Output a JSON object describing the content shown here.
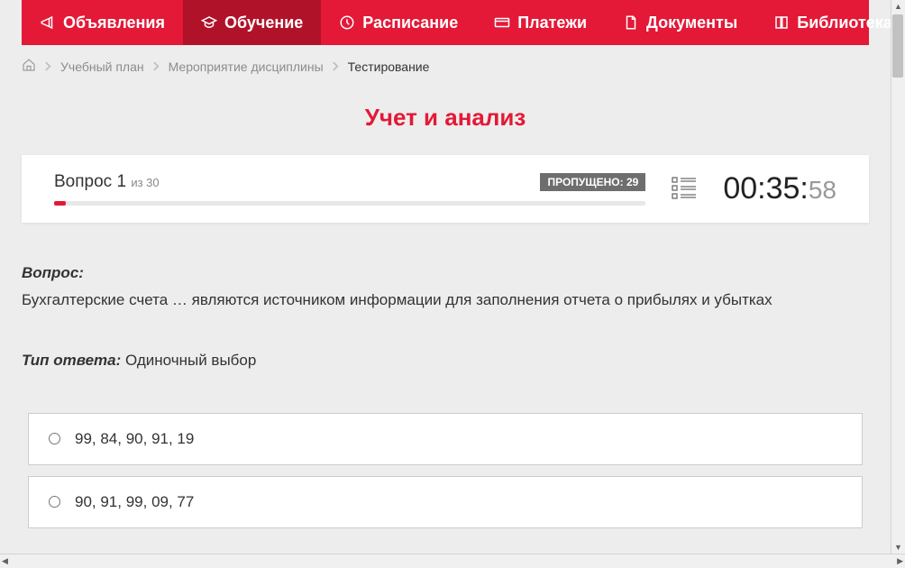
{
  "nav": {
    "items": [
      {
        "label": "Объявления",
        "icon": "megaphone"
      },
      {
        "label": "Обучение",
        "icon": "graduation",
        "active": true
      },
      {
        "label": "Расписание",
        "icon": "clock"
      },
      {
        "label": "Платежи",
        "icon": "card"
      },
      {
        "label": "Документы",
        "icon": "doc"
      },
      {
        "label": "Библиотека",
        "icon": "book",
        "dropdown": true
      }
    ]
  },
  "breadcrumb": {
    "items": [
      {
        "label": "Учебный план"
      },
      {
        "label": "Мероприятие дисциплины"
      }
    ],
    "current": "Тестирование"
  },
  "page_title": "Учет и анализ",
  "status": {
    "question_prefix": "Вопрос",
    "question_number": "1",
    "of_label": "из",
    "total": "30",
    "skipped_label": "ПРОПУЩЕНО:",
    "skipped_count": "29",
    "timer_main": "00:35:",
    "timer_seconds": "58"
  },
  "question": {
    "heading": "Вопрос:",
    "text": "Бухгалтерские счета … являются источником информации для заполнения отчета о прибылях и убытках",
    "answer_type_label": "Тип ответа:",
    "answer_type_value": "Одиночный выбор"
  },
  "options": [
    {
      "label": "99, 84, 90, 91, 19"
    },
    {
      "label": "90, 91, 99, 09, 77"
    }
  ]
}
